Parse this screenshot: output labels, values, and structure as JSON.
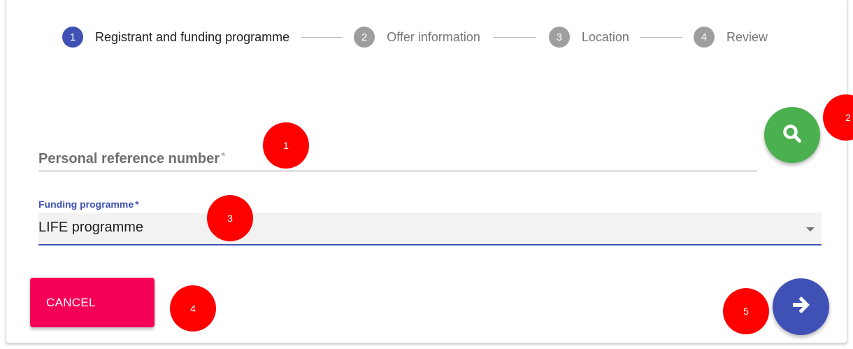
{
  "stepper": {
    "steps": [
      {
        "number": "1",
        "label": "Registrant and funding programme",
        "state": "active"
      },
      {
        "number": "2",
        "label": "Offer information",
        "state": "inactive"
      },
      {
        "number": "3",
        "label": "Location",
        "state": "inactive"
      },
      {
        "number": "4",
        "label": "Review",
        "state": "inactive"
      }
    ]
  },
  "form": {
    "reference_label": "Personal reference number",
    "reference_required": "*",
    "reference_value": "",
    "funding_label": "Funding programme",
    "funding_required": "*",
    "funding_value": "LIFE programme"
  },
  "actions": {
    "search_icon": "search-icon",
    "cancel_label": "CANCEL",
    "next_icon": "arrow-right-icon"
  },
  "annotations": [
    "1",
    "2",
    "3",
    "4",
    "5"
  ],
  "colors": {
    "primary": "#3f51b5",
    "search_green": "#4caf50",
    "cancel_pink": "#f50057",
    "marker_red": "#ff0000",
    "inactive_grey": "#9e9e9e"
  }
}
